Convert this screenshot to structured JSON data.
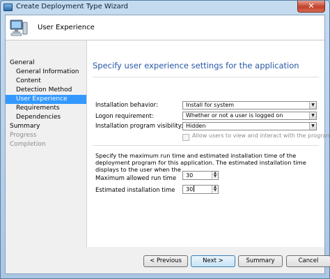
{
  "window": {
    "title": "Create Deployment Type Wizard",
    "close_glyph": "✕"
  },
  "header": {
    "title": "User Experience",
    "icon": "computer-icon"
  },
  "nav": {
    "items": [
      {
        "label": "General",
        "state": "normal",
        "level": 0
      },
      {
        "label": "General Information",
        "state": "normal",
        "level": 1
      },
      {
        "label": "Content",
        "state": "normal",
        "level": 1
      },
      {
        "label": "Detection Method",
        "state": "normal",
        "level": 1
      },
      {
        "label": "User Experience",
        "state": "selected",
        "level": 1
      },
      {
        "label": "Requirements",
        "state": "normal",
        "level": 1
      },
      {
        "label": "Dependencies",
        "state": "normal",
        "level": 1
      },
      {
        "label": "Summary",
        "state": "normal",
        "level": 0
      },
      {
        "label": "Progress",
        "state": "disabled",
        "level": 0
      },
      {
        "label": "Completion",
        "state": "disabled",
        "level": 0
      }
    ]
  },
  "panel": {
    "heading": "Specify user experience settings for the application",
    "installation_behavior": {
      "label": "Installation behavior:",
      "value": "Install for system"
    },
    "logon_requirement": {
      "label": "Logon requirement:",
      "value": "Whether or not a user is logged on"
    },
    "program_visibility": {
      "label": "Installation program visibility:",
      "value": "Hidden"
    },
    "allow_interact": {
      "label": "Allow users to view and interact with the program",
      "checked": false,
      "enabled": false
    },
    "description": "Specify the maximum run time and estimated installation time of the deployment program for this application. The estimated installation time displays to the user when the",
    "max_run_time": {
      "label": "Maximum allowed run time",
      "value": "30"
    },
    "estimated_time": {
      "label": "Estimated installation time",
      "value": "30"
    }
  },
  "buttons": {
    "previous": "< Previous",
    "next": "Next >",
    "summary": "Summary",
    "cancel": "Cancel"
  },
  "colors": {
    "accent_heading": "#2657a6",
    "nav_selected": "#3399ff"
  }
}
